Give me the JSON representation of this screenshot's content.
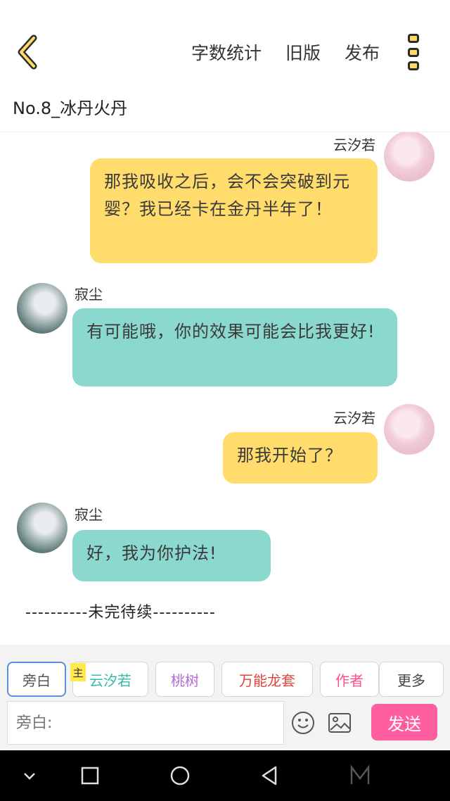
{
  "header": {
    "actions": [
      "字数统计",
      "旧版",
      "发布"
    ],
    "chapter_title": "No.8_冰丹火丹"
  },
  "messages": [
    {
      "speaker": "云汐若",
      "text": "那我吸收之后，会不会突破到元婴？我已经卡在金丹半年了！",
      "side": "right"
    },
    {
      "speaker": "寂尘",
      "text": "有可能哦，你的效果可能会比我更好!",
      "side": "left"
    },
    {
      "speaker": "云汐若",
      "text": "那我开始了？",
      "side": "right"
    },
    {
      "speaker": "寂尘",
      "text": "好，我为你护法!",
      "side": "left"
    }
  ],
  "to_be_continued": "----------未完待续----------",
  "composer": {
    "roles": [
      {
        "label": "旁白",
        "color": "#555555"
      },
      {
        "label": "云汐若",
        "color": "#38b8a8"
      },
      {
        "label": "桃树",
        "color": "#b46ad8"
      },
      {
        "label": "万能龙套",
        "color": "#e0443c"
      },
      {
        "label": "作者",
        "color": "#ff4f86"
      },
      {
        "label": "更多",
        "color": "#444444"
      }
    ],
    "main_badge": "主",
    "input_placeholder": "旁白:",
    "send_label": "发送"
  },
  "colors": {
    "bubble_self": "#ffdc6b",
    "bubble_other": "#8bd8cf",
    "send_button": "#ff5f9e"
  }
}
